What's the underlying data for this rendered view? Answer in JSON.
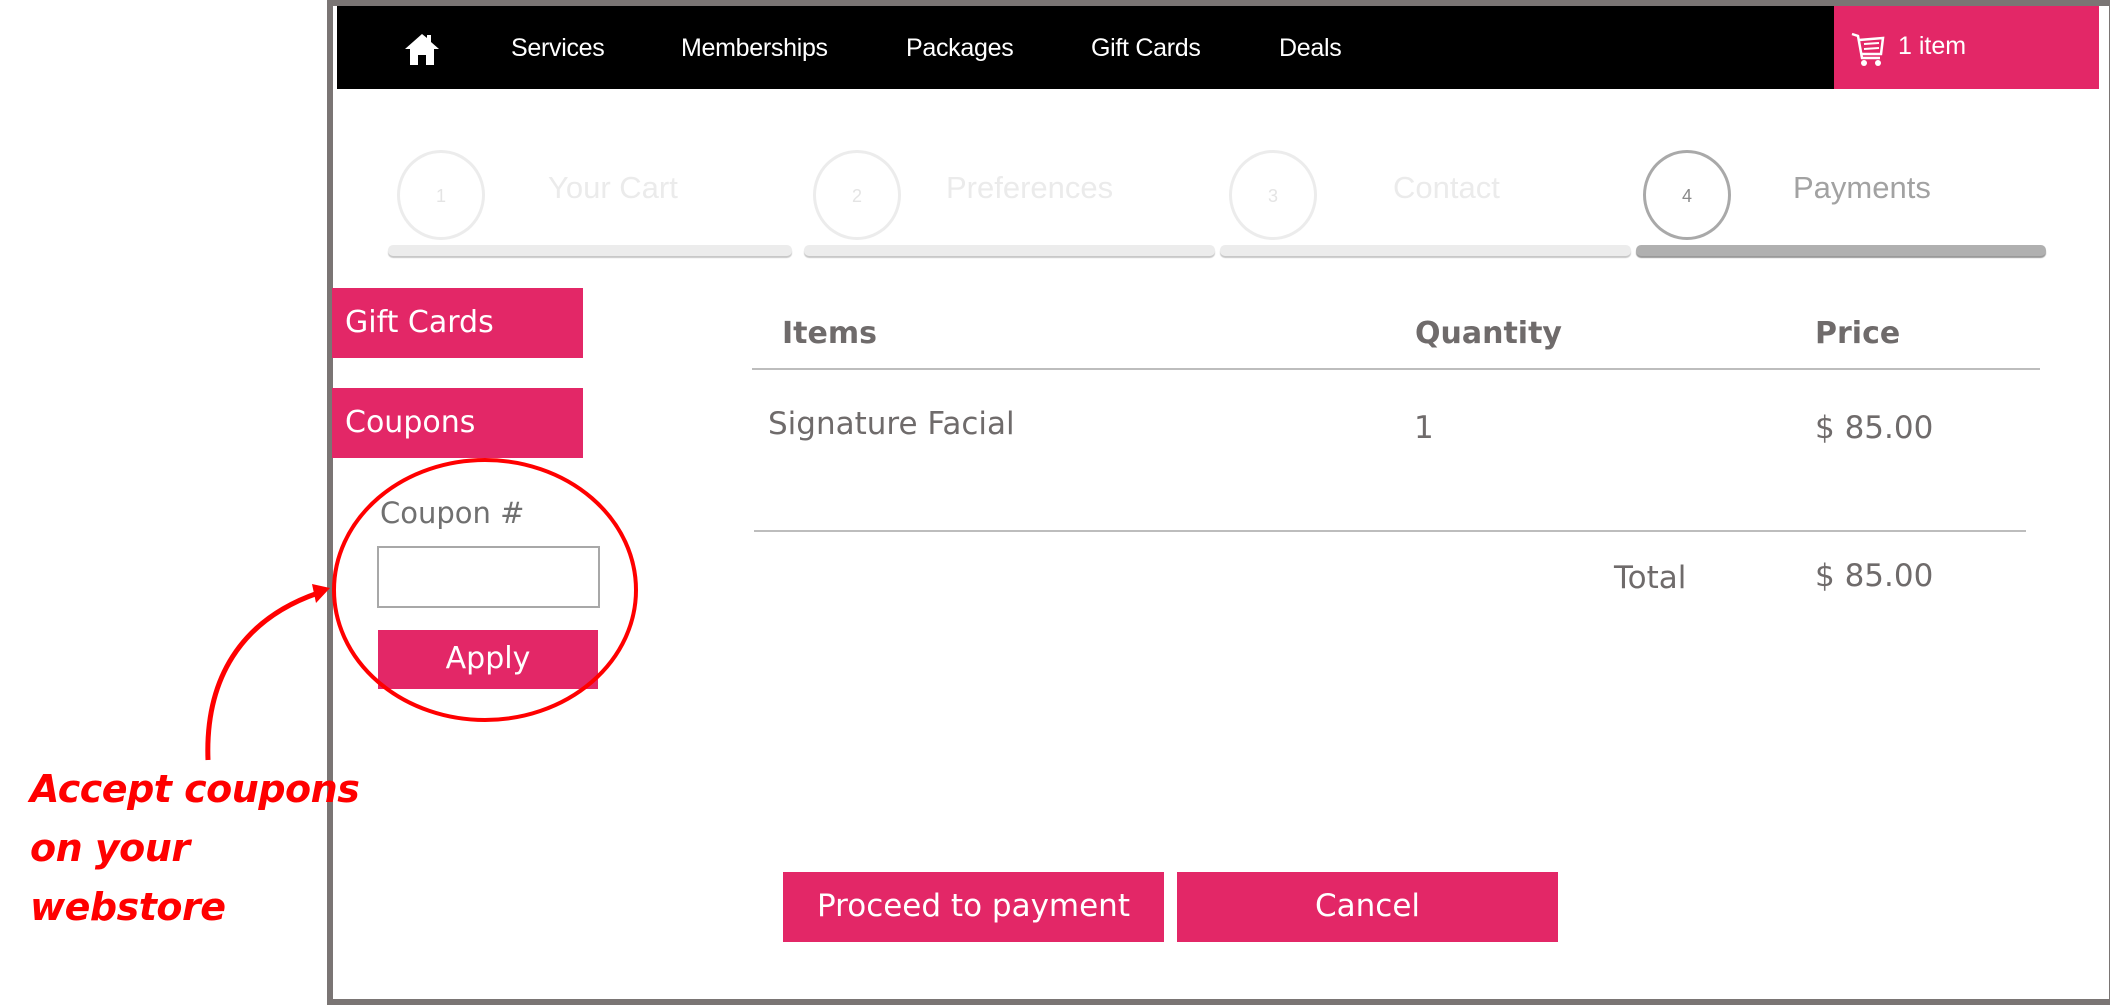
{
  "nav": {
    "home_icon": "home-icon",
    "items": [
      {
        "label": "Services"
      },
      {
        "label": "Memberships"
      },
      {
        "label": "Packages"
      },
      {
        "label": "Gift Cards"
      },
      {
        "label": "Deals"
      }
    ],
    "cart": {
      "icon": "cart-icon",
      "label": "1 item"
    }
  },
  "stepper": {
    "current_step": 4,
    "steps": [
      {
        "number": "1",
        "label": "Your Cart"
      },
      {
        "number": "2",
        "label": "Preferences"
      },
      {
        "number": "3",
        "label": "Contact"
      },
      {
        "number": "4",
        "label": "Payments"
      }
    ]
  },
  "sidebar": {
    "gift_cards_label": "Gift Cards",
    "coupons_label": "Coupons",
    "coupon_field_label": "Coupon #",
    "coupon_value": "",
    "coupon_placeholder": "",
    "apply_label": "Apply"
  },
  "cart_table": {
    "headers": [
      "Items",
      "Quantity",
      "Price"
    ],
    "rows": [
      {
        "item": "Signature Facial",
        "quantity": "1",
        "price": "$ 85.00"
      }
    ],
    "total_label": "Total",
    "total_value": "$ 85.00"
  },
  "actions": {
    "proceed_label": "Proceed to payment",
    "cancel_label": "Cancel"
  },
  "annotation": {
    "lines": [
      "Accept coupons",
      "on your",
      "webstore"
    ]
  },
  "colors": {
    "brand_pink": "#e32767",
    "nav_background": "#000000",
    "annotation_red": "#ff0000",
    "frame_gray": "#7a7574"
  }
}
